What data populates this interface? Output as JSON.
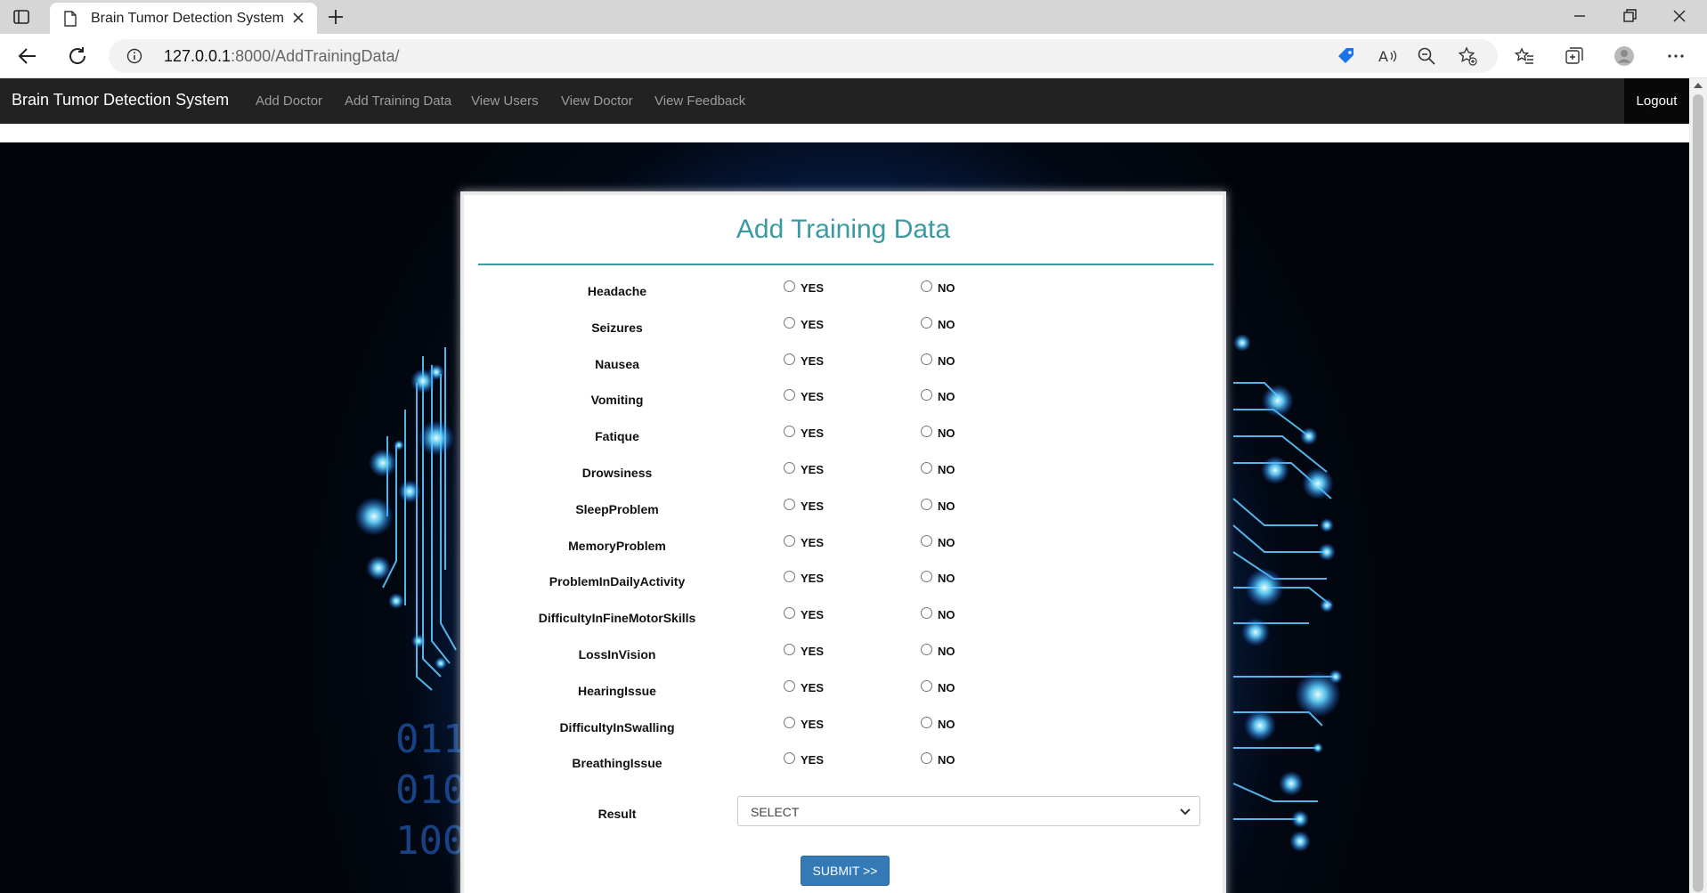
{
  "browser": {
    "tab_title": "Brain Tumor Detection System",
    "url_host": "127.0.0.1",
    "url_path": ":8000/AddTrainingData/"
  },
  "navbar": {
    "brand": "Brain Tumor Detection System",
    "links": [
      "Add Doctor",
      "Add Training Data",
      "View Users",
      "View Doctor",
      "View Feedback"
    ],
    "logout": "Logout"
  },
  "form": {
    "title": "Add Training Data",
    "yes_label": "YES",
    "no_label": "NO",
    "questions": [
      "Headache",
      "Seizures",
      "Nausea",
      "Vomiting",
      "Fatique",
      "Drowsiness",
      "SleepProblem",
      "MemoryProblem",
      "ProblemInDailyActivity",
      "DifficultyInFineMotorSkills",
      "LossInVision",
      "HearingIssue",
      "DifficultyInSwalling",
      "BreathingIssue"
    ],
    "result_label": "Result",
    "result_value": "SELECT",
    "submit": "SUBMIT >>"
  },
  "background": {
    "binary_lines": [
      "011",
      "010",
      "100"
    ]
  },
  "colors": {
    "navbar": "#222222",
    "title": "#3a9aa3",
    "submit": "#337ab7"
  }
}
